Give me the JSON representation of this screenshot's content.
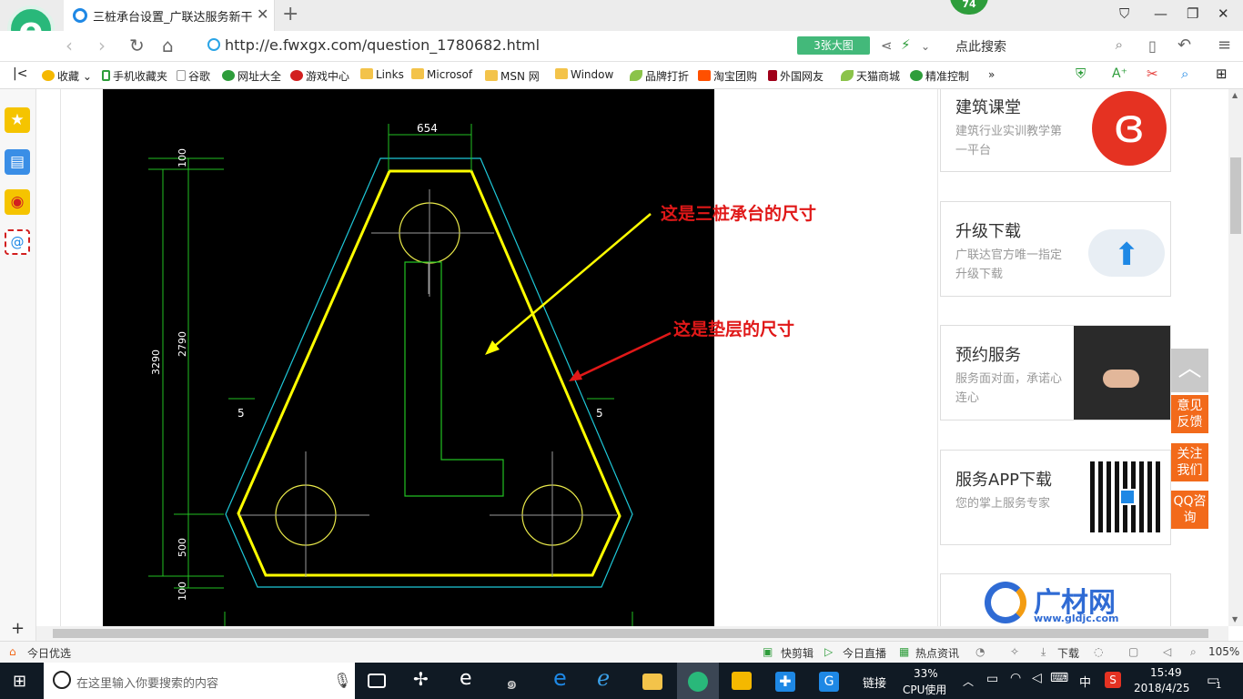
{
  "browser": {
    "tab_title": "三桩承台设置_广联达服务新干线",
    "badge": "74",
    "url": "http://e.fwxgx.com/question_1780682.html",
    "bigpic_label": "3张大图",
    "search_placeholder": "点此搜索"
  },
  "bookmarks": [
    {
      "label": "收藏",
      "icon": "star-icon"
    },
    {
      "label": "手机收藏夹",
      "icon": "phone-icon"
    },
    {
      "label": "谷歌",
      "icon": "page-icon"
    },
    {
      "label": "网址大全",
      "icon": "globe-icon"
    },
    {
      "label": "游戏中心",
      "icon": "game-icon"
    },
    {
      "label": "Links",
      "icon": "folder-icon"
    },
    {
      "label": "Microsof",
      "icon": "folder-icon"
    },
    {
      "label": "MSN 网",
      "icon": "folder-icon"
    },
    {
      "label": "Window",
      "icon": "folder-icon"
    },
    {
      "label": "品牌打折",
      "icon": "leaf-icon"
    },
    {
      "label": "淘宝团购",
      "icon": "taobao-icon"
    },
    {
      "label": "外国网友",
      "icon": "flag-icon"
    },
    {
      "label": "天猫商城",
      "icon": "leaf-icon"
    },
    {
      "label": "精准控制",
      "icon": "chat-icon"
    }
  ],
  "cad": {
    "dim_top": "654",
    "dim_left_total": "3290",
    "dim_left_top": "100",
    "dim_left_mid": "2790",
    "dim_left_500": "500",
    "dim_left_bottom": "100",
    "dim_side_left": "5",
    "dim_side_right": "5",
    "note_cap": "这是三桩承台的尺寸",
    "note_cushion": "这是垫层的尺寸"
  },
  "cards": [
    {
      "title": "建筑课堂",
      "desc": "建筑行业实训教学第一平台"
    },
    {
      "title": "升级下载",
      "desc": "广联达官方唯一指定升级下载"
    },
    {
      "title": "预约服务",
      "desc": "服务面对面，承诺心连心"
    },
    {
      "title": "服务APP下载",
      "desc": "您的掌上服务专家"
    },
    {
      "title": "广材网",
      "desc": "www.gldjc.com"
    }
  ],
  "float_buttons": [
    "意见反馈",
    "关注我们",
    "QQ咨询"
  ],
  "statusbar": {
    "left": "今日优选",
    "quickcut": "快剪辑",
    "live": "今日直播",
    "news": "热点资讯",
    "download": "下载",
    "zoom": "105%"
  },
  "taskbar": {
    "search_placeholder": "在这里输入你要搜索的内容",
    "link_label": "链接",
    "cpu_percent": "33%",
    "cpu_label": "CPU使用",
    "ime": "中",
    "time": "15:49",
    "date": "2018/4/25",
    "notif_count": "1"
  }
}
